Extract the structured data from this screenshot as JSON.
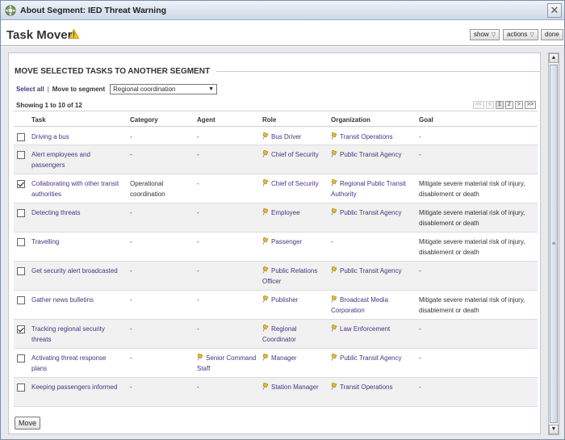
{
  "window": {
    "title": "About Segment: IED Threat Warning"
  },
  "header": {
    "page_title": "Task Mover",
    "show_label": "show",
    "actions_label": "actions",
    "done_label": "done"
  },
  "section": {
    "title": "MOVE SELECTED TASKS TO ANOTHER SEGMENT",
    "select_all": "Select all",
    "separator": "|",
    "move_to_label": "Move to segment",
    "segment_value": "Regional coordination",
    "move_button": "Move"
  },
  "paging": {
    "showing": "Showing 1 to 10 of 12",
    "first": "<<",
    "prev": "<",
    "page1": "1",
    "page2": "2",
    "next": ">",
    "last": ">>"
  },
  "table": {
    "columns": {
      "task": "Task",
      "category": "Category",
      "agent": "Agent",
      "role": "Role",
      "organization": "Organization",
      "goal": "Goal"
    },
    "rows": [
      {
        "checked": false,
        "task": "Driving a bus",
        "category": "-",
        "agent": "-",
        "role": "Bus Driver",
        "organization": "Transit Operations",
        "goal": "-"
      },
      {
        "checked": false,
        "task": "Alert employees and passengers",
        "category": "-",
        "agent": "-",
        "role": "Chief of Security",
        "organization": "Public Transit Agency",
        "goal": "-"
      },
      {
        "checked": true,
        "task": "Collaborating with other transit authorities",
        "category": "Operational coordination",
        "agent": "-",
        "role": "Chief of Security",
        "organization": "Regional Public Transit Authority",
        "goal": "Mitigate severe material risk of injury, disablement or death"
      },
      {
        "checked": false,
        "task": "Detecting threats",
        "category": "-",
        "agent": "-",
        "role": "Employee",
        "organization": "Public Transit Agency",
        "goal": "Mitigate severe material risk of injury, disablement or death"
      },
      {
        "checked": false,
        "task": "Travelling",
        "category": "-",
        "agent": "-",
        "role": "Passenger",
        "organization": "-",
        "goal": "Mitigate severe material risk of injury, disablement or death"
      },
      {
        "checked": false,
        "task": "Get security alert broadcasted",
        "category": "-",
        "agent": "-",
        "role": "Public Relations Officer",
        "organization": "Public Transit Agency",
        "goal": "-"
      },
      {
        "checked": false,
        "task": "Gather news bulletins",
        "category": "-",
        "agent": "-",
        "role": "Publisher",
        "organization": "Broadcast Media Corporation",
        "goal": "Mitigate severe material risk of injury, disablement or death"
      },
      {
        "checked": true,
        "task": "Tracking regional security threats",
        "category": "-",
        "agent": "-",
        "role": "Regional Coordinator",
        "organization": "Law Enforcement",
        "goal": "-"
      },
      {
        "checked": false,
        "task": "Activating threat response plans",
        "category": "-",
        "agent": "Senior Command Staff",
        "role": "Manager",
        "organization": "Public Transit Agency",
        "goal": "-"
      },
      {
        "checked": false,
        "task": "Keeping passengers informed",
        "category": "-",
        "agent": "-",
        "role": "Station Manager",
        "organization": "Transit Operations",
        "goal": "-"
      }
    ]
  }
}
